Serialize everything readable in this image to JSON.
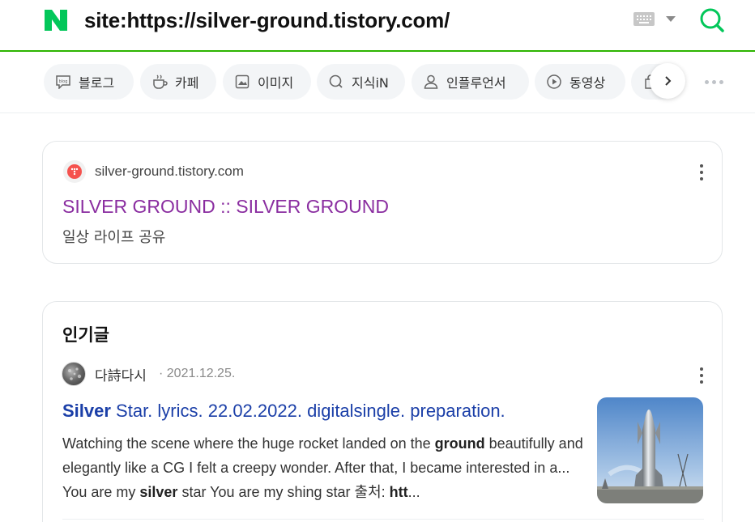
{
  "header": {
    "query": "site:https://silver-ground.tistory.com/",
    "logo_icon": "naver-n-logo",
    "brand_color": "#03c75a"
  },
  "tabs": [
    {
      "label": "블로그",
      "icon": "blog-icon"
    },
    {
      "label": "카페",
      "icon": "cafe-icon"
    },
    {
      "label": "이미지",
      "icon": "image-icon"
    },
    {
      "label": "지식iN",
      "icon": "kin-icon"
    },
    {
      "label": "인플루언서",
      "icon": "influencer-icon"
    },
    {
      "label": "동영상",
      "icon": "video-icon"
    },
    {
      "label": "",
      "icon": "shopping-icon"
    }
  ],
  "site_card": {
    "domain": "silver-ground.tistory.com",
    "title": "SILVER GROUND :: SILVER GROUND",
    "description": "일상 라이프 공유",
    "title_color": "#8a2da0"
  },
  "popular": {
    "section_title": "인기글",
    "author": "다詩다시",
    "date": "· 2021.12.25.",
    "post_title_highlight": "Silver",
    "post_title_rest": " Star. lyrics. 22.02.2022. digitalsingle. preparation.",
    "body_parts": [
      {
        "text": "Watching the scene where the huge rocket landed on the ",
        "bold": false
      },
      {
        "text": "ground",
        "bold": true
      },
      {
        "text": " beautifully and elegantly like a CG I felt a creepy wonder. After that, I became interested in a... You are my ",
        "bold": false
      },
      {
        "text": "silver",
        "bold": true
      },
      {
        "text": " star You are my shing star 출처: ",
        "bold": false
      },
      {
        "text": "htt",
        "bold": true
      },
      {
        "text": "...",
        "bold": false
      }
    ]
  }
}
